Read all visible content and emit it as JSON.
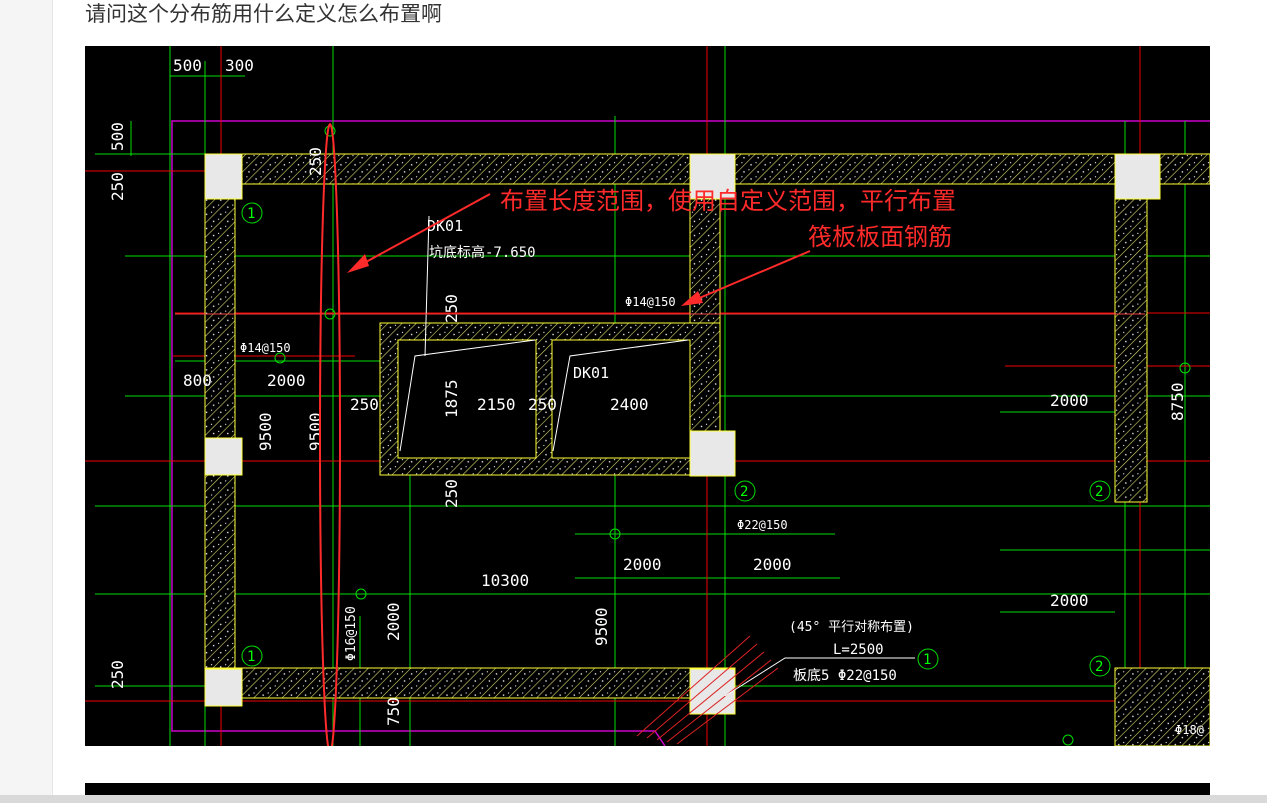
{
  "question": {
    "text": "请问这个分布筋用什么定义怎么布置啊"
  },
  "annotations": {
    "line1": "布置长度范围，使用自定义范围，平行布置",
    "line2": "筏板板面钢筋"
  },
  "drawing": {
    "dims": {
      "d500": "500",
      "d300": "300",
      "d500v": "500",
      "d250a": "250",
      "d250b": "250",
      "d800": "800",
      "d2000a": "2000",
      "d9500a": "9500",
      "d9500b": "9500",
      "d250c": "250",
      "d250d": "250",
      "d1875": "1875",
      "d2150": "2150",
      "d250e": "250",
      "d2400": "2400",
      "d250f": "250",
      "d2000b": "2000",
      "d2000c": "2000",
      "d10300": "10300",
      "d2000d": "2000",
      "d9500c": "9500",
      "d2000e": "2000",
      "d250g": "250",
      "d750": "750",
      "d8750": "8750",
      "d2000f": "2000"
    },
    "labels": {
      "dk01a": "DK01",
      "pit_elev": "坑底标高-7.650",
      "dk01b": "DK01",
      "rebar_14a": "Φ14@150",
      "rebar_14b": "Φ14@150",
      "rebar_22": "Φ22@150",
      "rebar_16": "Φ16@150",
      "note45": "(45° 平行对称布置)",
      "len": "L=2500",
      "slab5": "板底5 Φ22@150",
      "rebar_18": "Φ18@"
    },
    "marks": {
      "one": "1",
      "two": "2"
    }
  },
  "colors": {
    "background": "#000000",
    "grid_green": "#00ff00",
    "axis_red": "#ff0000",
    "wall_yellow": "#ffff33",
    "boundary_magenta": "#cc00cc",
    "annotation_red": "#ff2a2a",
    "text_white": "#ffffff"
  }
}
